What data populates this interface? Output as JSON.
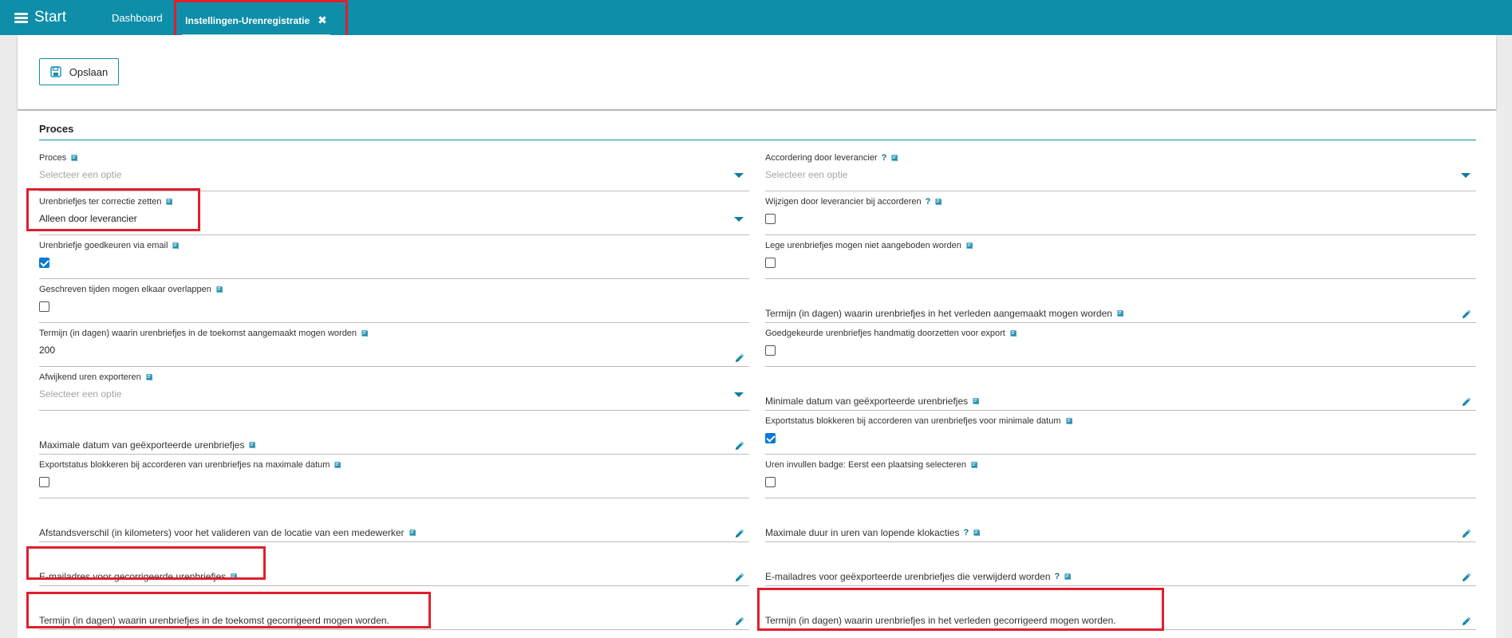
{
  "topbar": {
    "start_label": "Start",
    "dashboard_tab": "Dashboard",
    "active_tab": "Instellingen-Urenregistratie",
    "close_glyph": "✖"
  },
  "toolbar": {
    "save_label": "Opslaan",
    "save_icon": "floppy-disk-icon"
  },
  "section": {
    "title": "Proces"
  },
  "placeholder": "Selecteer een optie",
  "fields": {
    "proces": {
      "label": "Proces"
    },
    "accordering": {
      "label": "Accordering door leverancier",
      "help": "?"
    },
    "correctie": {
      "label": "Urenbriefjes ter correctie zetten",
      "value": "Alleen door leverancier"
    },
    "wijzigen": {
      "label": "Wijzigen door leverancier bij accorderen",
      "help": "?",
      "checked": false
    },
    "goedkeuren_email": {
      "label": "Urenbriefje goedkeuren via email",
      "checked": true
    },
    "lege": {
      "label": "Lege urenbriefjes mogen niet aangeboden worden",
      "checked": false
    },
    "overlappen": {
      "label": "Geschreven tijden mogen elkaar overlappen",
      "checked": false
    },
    "termijn_verleden_aanmaak": {
      "label": "Termijn (in dagen) waarin urenbriefjes in het verleden aangemaakt mogen worden"
    },
    "termijn_toekomst_aanmaak": {
      "label": "Termijn (in dagen) waarin urenbriefjes in de toekomst aangemaakt mogen worden",
      "value": "200"
    },
    "handmatig_export": {
      "label": "Goedgekeurde urenbriefjes handmatig doorzetten voor export",
      "checked": false
    },
    "afwijkend": {
      "label": "Afwijkend uren exporteren"
    },
    "min_datum": {
      "label": "Minimale datum van geëxporteerde urenbriefjes"
    },
    "max_datum": {
      "label": "Maximale datum van geëxporteerde urenbriefjes"
    },
    "blok_min": {
      "label": "Exportstatus blokkeren bij accorderen van urenbriefjes voor minimale datum",
      "checked": true
    },
    "blok_max": {
      "label": "Exportstatus blokkeren bij accorderen van urenbriefjes na maximale datum",
      "checked": false
    },
    "badge": {
      "label": "Uren invullen badge: Eerst een plaatsing selecteren",
      "checked": false
    },
    "afstand": {
      "label": "Afstandsverschil (in kilometers) voor het valideren van de locatie van een medewerker"
    },
    "klokacties": {
      "label": "Maximale duur in uren van lopende klokacties",
      "help": "?"
    },
    "email_gecorr": {
      "label": "E-mailadres voor gecorrigeerde urenbriefjes"
    },
    "email_verwijderd": {
      "label": "E-mailadres voor geëxporteerde urenbriefjes die verwijderd worden",
      "help": "?"
    },
    "termijn_toekomst_corr": {
      "label": "Termijn (in dagen) waarin urenbriefjes in de toekomst gecorrigeerd mogen worden."
    },
    "termijn_verleden_corr": {
      "label": "Termijn (in dagen) waarin urenbriefjes in het verleden gecorrigeerd mogen worden."
    }
  },
  "colors": {
    "brand": "#0e8ea8",
    "highlight": "#e01f2d",
    "checkbox_on": "#0a78d4"
  }
}
